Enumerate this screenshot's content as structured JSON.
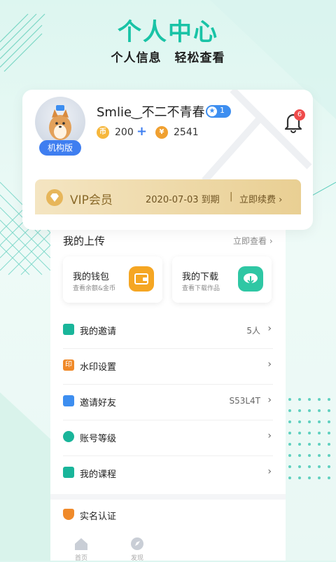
{
  "hero": {
    "title": "个人中心",
    "subtitle_left": "个人信息",
    "subtitle_right": "轻松查看"
  },
  "profile": {
    "username": "Smlie‿不二不青春",
    "level_badge": "1",
    "org_badge": "机构版",
    "coins": "200",
    "points": "2541",
    "coin_symbol": "币",
    "points_symbol": "¥",
    "notification_count": "6"
  },
  "vip": {
    "label": "VIP会员",
    "expiry": "2020-07-03 到期",
    "separator": "|",
    "renew": "立即续费"
  },
  "uploads": {
    "title": "我的上传",
    "link": "立即查看"
  },
  "tiles": [
    {
      "title": "我的钱包",
      "subtitle": "查看余额&金币",
      "icon": "wallet-icon",
      "color": "#f5a623"
    },
    {
      "title": "我的下载",
      "subtitle": "查看下载作品",
      "icon": "download-icon",
      "color": "#2fc7a4"
    }
  ],
  "menu": [
    {
      "label": "我的邀请",
      "value": "5人",
      "icon": "invite-icon",
      "color": "#19b59a"
    },
    {
      "label": "水印设置",
      "value": "",
      "icon": "watermark-icon",
      "icon_text": "印",
      "color": "#f08a2a"
    },
    {
      "label": "邀请好友",
      "value": "S53L4T",
      "icon": "mail-icon",
      "color": "#3d8ef0"
    },
    {
      "label": "账号等级",
      "value": "",
      "icon": "level-icon",
      "color": "#19b59a"
    },
    {
      "label": "我的课程",
      "value": "",
      "icon": "course-icon",
      "color": "#19b59a"
    },
    {
      "label": "实名认证",
      "value": "",
      "icon": "shield-icon",
      "color": "#f08a2a"
    }
  ],
  "tabbar": [
    {
      "label": "首页",
      "icon": "home-icon"
    },
    {
      "label": "发现",
      "icon": "discover-icon"
    }
  ],
  "colors": {
    "accent": "#19c3a6",
    "vip_gold": "#e9cf93",
    "blue": "#3f7ef0"
  }
}
